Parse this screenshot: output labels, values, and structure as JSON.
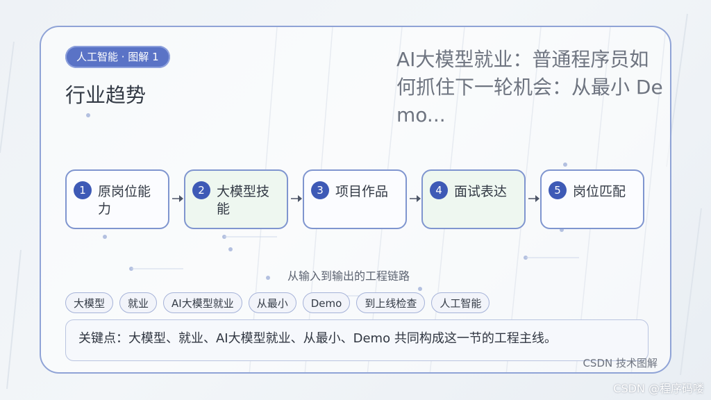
{
  "badge": "人工智能 · 图解 1",
  "subtitle": "行业趋势",
  "title": "AI大模型就业：普通程序员如何抓住下一轮机会：从最小 Demo...",
  "steps": [
    {
      "num": "1",
      "label": "原岗位能力"
    },
    {
      "num": "2",
      "label": "大模型技能"
    },
    {
      "num": "3",
      "label": "项目作品"
    },
    {
      "num": "4",
      "label": "面试表达"
    },
    {
      "num": "5",
      "label": "岗位匹配"
    }
  ],
  "chain_caption": "从输入到输出的工程链路",
  "tags": [
    "大模型",
    "就业",
    "AI大模型就业",
    "从最小",
    "Demo",
    "到上线检查",
    "人工智能"
  ],
  "keypoint": "关键点：大模型、就业、AI大模型就业、从最小、Demo 共同构成这一节的工程主线。",
  "footer_note": "CSDN 技术图解",
  "watermark": "CSDN @程序码喽",
  "colors": {
    "accent": "#5a73c6",
    "step_border": "#7f95cf",
    "step_alt_bg": "#eef7f0"
  }
}
